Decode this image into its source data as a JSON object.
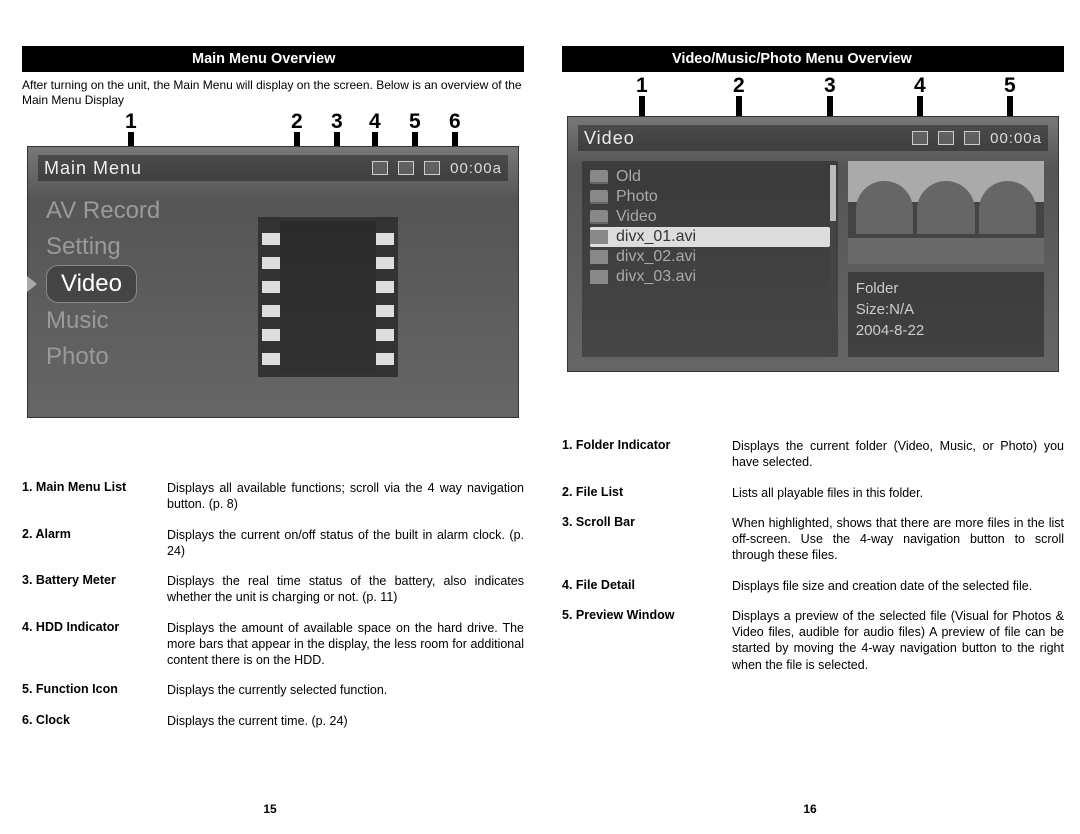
{
  "left": {
    "header": "Main Menu Overview",
    "intro": "After turning on the unit, the Main Menu will display on the screen. Below is an overview of the Main Menu Display",
    "callouts": [
      "1",
      "2",
      "3",
      "4",
      "5",
      "6"
    ],
    "shot": {
      "title": "Main Menu",
      "clock": "00:00a",
      "items": [
        "AV Record",
        "Setting",
        "Video",
        "Music",
        "Photo"
      ],
      "selected_index": 2
    },
    "legend": [
      {
        "n": "1.",
        "term": "Main Menu List",
        "desc": "Displays all available functions; scroll via the 4 way navigation button. (p. 8)"
      },
      {
        "n": "2.",
        "term": "Alarm",
        "desc": "Displays the current on/off status of the built in alarm clock. (p. 24)"
      },
      {
        "n": "3.",
        "term": "Battery Meter",
        "desc": "Displays the real time status of the battery, also indicates whether the unit is charging or not. (p. 11)"
      },
      {
        "n": "4.",
        "term": "HDD Indicator",
        "desc": "Displays the amount of available space on the hard drive. The more bars that appear in the display, the less room for additional content there is on the HDD."
      },
      {
        "n": "5.",
        "term": "Function Icon",
        "desc": "Displays the currently selected function."
      },
      {
        "n": "6.",
        "term": "Clock",
        "desc": "Displays the current time. (p. 24)"
      }
    ],
    "page_num": "15"
  },
  "right": {
    "header": "Video/Music/Photo Menu Overview",
    "callouts": [
      "1",
      "2",
      "3",
      "4",
      "5"
    ],
    "shot": {
      "title": "Video",
      "clock": "00:00a",
      "files": [
        {
          "type": "folder",
          "name": "Old"
        },
        {
          "type": "folder",
          "name": "Photo"
        },
        {
          "type": "folder",
          "name": "Video"
        },
        {
          "type": "file",
          "name": "divx_01.avi"
        },
        {
          "type": "file",
          "name": "divx_02.avi"
        },
        {
          "type": "file",
          "name": "divx_03.avi"
        }
      ],
      "selected_file_index": 3,
      "detail": [
        "Folder",
        "Size:N/A",
        "2004-8-22"
      ]
    },
    "legend": [
      {
        "n": "1.",
        "term": "Folder Indicator",
        "desc": "Displays the current folder (Video, Music, or Photo) you have selected."
      },
      {
        "n": "2.",
        "term": "File List",
        "desc": "Lists all playable files in this folder."
      },
      {
        "n": "3.",
        "term": "Scroll Bar",
        "desc": "When highlighted, shows that there are more files in the list off-screen. Use the 4-way navigation button to scroll through these files."
      },
      {
        "n": "4.",
        "term": "File Detail",
        "desc": "Displays file size and creation date of the selected file."
      },
      {
        "n": "5.",
        "term": "Preview Window",
        "desc": "Displays a preview of the selected file (Visual for Photos & Video files, audible for audio files) A preview of file can be started by moving the 4-way navigation button to the right when the file is selected."
      }
    ],
    "page_num": "16"
  }
}
